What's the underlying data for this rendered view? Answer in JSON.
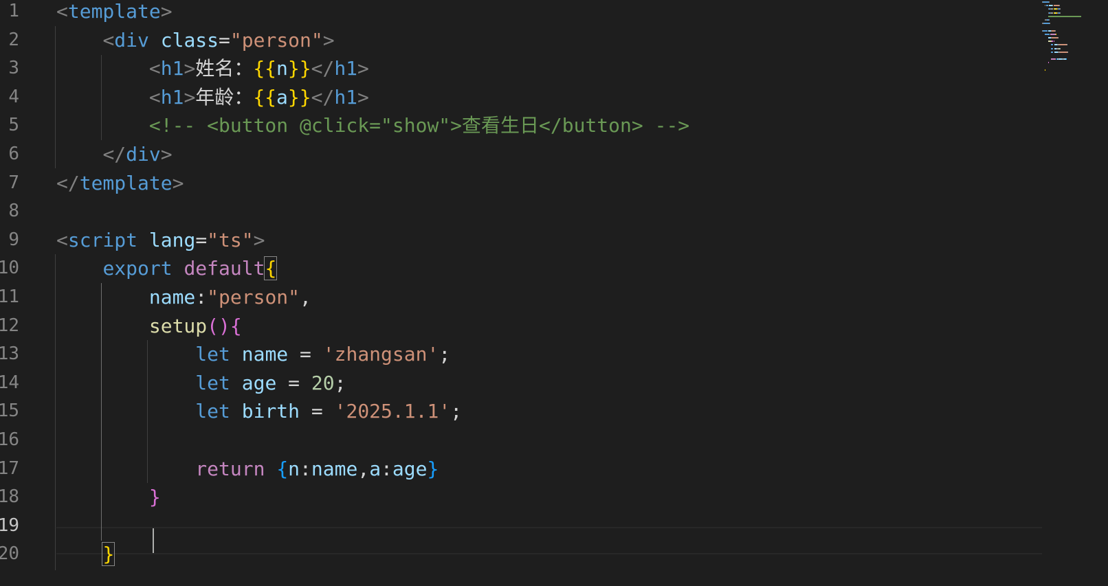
{
  "editor": {
    "line_numbers": [
      "1",
      "2",
      "3",
      "4",
      "5",
      "6",
      "7",
      "8",
      "9",
      "10",
      "11",
      "12",
      "13",
      "14",
      "15",
      "16",
      "17",
      "18",
      "19",
      "20"
    ],
    "lines": [
      {
        "tokens": [
          {
            "t": "<",
            "c": "punc"
          },
          {
            "t": "template",
            "c": "tag"
          },
          {
            "t": ">",
            "c": "punc"
          }
        ]
      },
      {
        "tokens": [
          {
            "t": "    ",
            "c": "text"
          },
          {
            "t": "<",
            "c": "punc"
          },
          {
            "t": "div",
            "c": "tag"
          },
          {
            "t": " ",
            "c": "text"
          },
          {
            "t": "class",
            "c": "attr"
          },
          {
            "t": "=",
            "c": "text"
          },
          {
            "t": "\"person\"",
            "c": "str"
          },
          {
            "t": ">",
            "c": "punc"
          }
        ]
      },
      {
        "tokens": [
          {
            "t": "        ",
            "c": "text"
          },
          {
            "t": "<",
            "c": "punc"
          },
          {
            "t": "h1",
            "c": "tag"
          },
          {
            "t": ">",
            "c": "punc"
          },
          {
            "t": "姓名：",
            "c": "text"
          },
          {
            "t": "{{",
            "c": "br"
          },
          {
            "t": "n",
            "c": "var"
          },
          {
            "t": "}}",
            "c": "br"
          },
          {
            "t": "</",
            "c": "punc"
          },
          {
            "t": "h1",
            "c": "tag"
          },
          {
            "t": ">",
            "c": "punc"
          }
        ]
      },
      {
        "tokens": [
          {
            "t": "        ",
            "c": "text"
          },
          {
            "t": "<",
            "c": "punc"
          },
          {
            "t": "h1",
            "c": "tag"
          },
          {
            "t": ">",
            "c": "punc"
          },
          {
            "t": "年龄：",
            "c": "text"
          },
          {
            "t": "{{",
            "c": "br"
          },
          {
            "t": "a",
            "c": "var"
          },
          {
            "t": "}}",
            "c": "br"
          },
          {
            "t": "</",
            "c": "punc"
          },
          {
            "t": "h1",
            "c": "tag"
          },
          {
            "t": ">",
            "c": "punc"
          }
        ]
      },
      {
        "tokens": [
          {
            "t": "        ",
            "c": "text"
          },
          {
            "t": "<!-- <button @click=\"show\">查看生日</button> -->",
            "c": "cmt"
          }
        ]
      },
      {
        "tokens": [
          {
            "t": "    ",
            "c": "text"
          },
          {
            "t": "</",
            "c": "punc"
          },
          {
            "t": "div",
            "c": "tag"
          },
          {
            "t": ">",
            "c": "punc"
          }
        ]
      },
      {
        "tokens": [
          {
            "t": "</",
            "c": "punc"
          },
          {
            "t": "template",
            "c": "tag"
          },
          {
            "t": ">",
            "c": "punc"
          }
        ]
      },
      {
        "tokens": []
      },
      {
        "tokens": [
          {
            "t": "<",
            "c": "punc"
          },
          {
            "t": "script",
            "c": "tag"
          },
          {
            "t": " ",
            "c": "text"
          },
          {
            "t": "lang",
            "c": "attr"
          },
          {
            "t": "=",
            "c": "text"
          },
          {
            "t": "\"ts\"",
            "c": "str"
          },
          {
            "t": ">",
            "c": "punc"
          }
        ]
      },
      {
        "tokens": [
          {
            "t": "    ",
            "c": "text"
          },
          {
            "t": "export",
            "c": "kw"
          },
          {
            "t": " ",
            "c": "text"
          },
          {
            "t": "default",
            "c": "kw2"
          },
          {
            "t": "{",
            "c": "br bm"
          }
        ]
      },
      {
        "tokens": [
          {
            "t": "        ",
            "c": "text"
          },
          {
            "t": "name",
            "c": "var"
          },
          {
            "t": ":",
            "c": "text"
          },
          {
            "t": "\"person\"",
            "c": "str"
          },
          {
            "t": ",",
            "c": "text"
          }
        ]
      },
      {
        "tokens": [
          {
            "t": "        ",
            "c": "text"
          },
          {
            "t": "setup",
            "c": "fn"
          },
          {
            "t": "()",
            "c": "br2"
          },
          {
            "t": "{",
            "c": "br2"
          }
        ]
      },
      {
        "tokens": [
          {
            "t": "            ",
            "c": "text"
          },
          {
            "t": "let",
            "c": "kw"
          },
          {
            "t": " ",
            "c": "text"
          },
          {
            "t": "name",
            "c": "var"
          },
          {
            "t": " = ",
            "c": "text"
          },
          {
            "t": "'zhangsan'",
            "c": "str"
          },
          {
            "t": ";",
            "c": "text"
          }
        ]
      },
      {
        "tokens": [
          {
            "t": "            ",
            "c": "text"
          },
          {
            "t": "let",
            "c": "kw"
          },
          {
            "t": " ",
            "c": "text"
          },
          {
            "t": "age",
            "c": "var"
          },
          {
            "t": " = ",
            "c": "text"
          },
          {
            "t": "20",
            "c": "num"
          },
          {
            "t": ";",
            "c": "text"
          }
        ]
      },
      {
        "tokens": [
          {
            "t": "            ",
            "c": "text"
          },
          {
            "t": "let",
            "c": "kw"
          },
          {
            "t": " ",
            "c": "text"
          },
          {
            "t": "birth",
            "c": "var"
          },
          {
            "t": " = ",
            "c": "text"
          },
          {
            "t": "'2025.1.1'",
            "c": "str"
          },
          {
            "t": ";",
            "c": "text"
          }
        ]
      },
      {
        "tokens": []
      },
      {
        "tokens": [
          {
            "t": "            ",
            "c": "text"
          },
          {
            "t": "return",
            "c": "kw2"
          },
          {
            "t": " ",
            "c": "text"
          },
          {
            "t": "{",
            "c": "br3"
          },
          {
            "t": "n",
            "c": "var"
          },
          {
            "t": ":",
            "c": "text"
          },
          {
            "t": "name",
            "c": "var"
          },
          {
            "t": ",",
            "c": "text"
          },
          {
            "t": "a",
            "c": "var"
          },
          {
            "t": ":",
            "c": "text"
          },
          {
            "t": "age",
            "c": "var"
          },
          {
            "t": "}",
            "c": "br3"
          }
        ]
      },
      {
        "tokens": [
          {
            "t": "        ",
            "c": "text"
          },
          {
            "t": "}",
            "c": "br2"
          }
        ]
      },
      {
        "tokens": []
      },
      {
        "tokens": [
          {
            "t": "    ",
            "c": "text"
          },
          {
            "t": "}",
            "c": "br bm"
          }
        ]
      }
    ],
    "current_line": "19"
  },
  "colors": {
    "background": "#1e1e1e",
    "tag": "#569cd6",
    "attribute": "#9cdcfe",
    "string": "#ce9178",
    "comment": "#6a9955",
    "bracket_gold": "#ffd700",
    "bracket_orchid": "#da70d6",
    "bracket_blue": "#179fff"
  }
}
